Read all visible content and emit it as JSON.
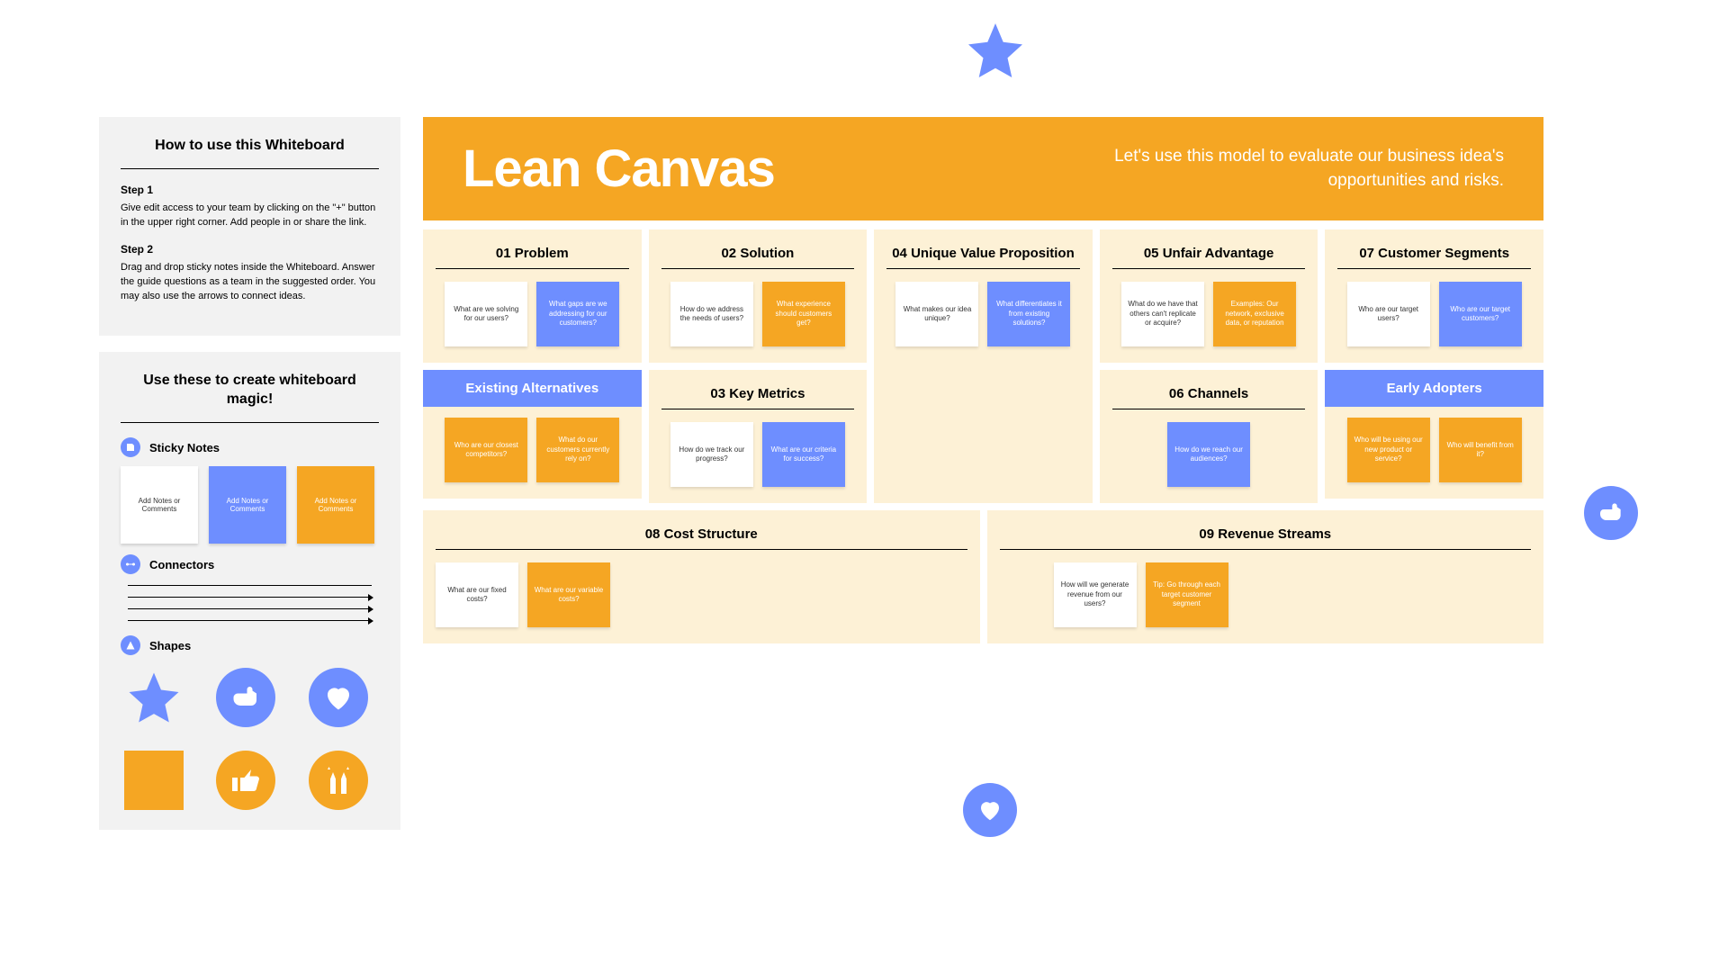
{
  "sidebar": {
    "howto_title": "How to use this Whiteboard",
    "step1_h": "Step 1",
    "step1_body": "Give edit access to your team by clicking on the \"+\" button in the upper right corner. Add people in or share the link.",
    "step2_h": "Step 2",
    "step2_body": "Drag and drop sticky notes inside the Whiteboard. Answer the guide questions as a team in the suggested order. You may also use the arrows to connect ideas.",
    "magic_title": "Use these to create whiteboard magic!",
    "sticky_label": "Sticky Notes",
    "sticky_white": "Add Notes or Comments",
    "sticky_blue": "Add Notes or Comments",
    "sticky_orange": "Add Notes or Comments",
    "connectors_label": "Connectors",
    "shapes_label": "Shapes"
  },
  "banner": {
    "title": "Lean Canvas",
    "subtitle": "Let's use this model to evaluate our business idea's opportunities and risks."
  },
  "blocks": {
    "problem": {
      "h": "01 Problem",
      "n1": "What are we solving for our users?",
      "n2": "What gaps are we addressing for our customers?"
    },
    "existing": {
      "h": "Existing Alternatives",
      "n1": "Who are our closest competitors?",
      "n2": "What do our customers currently rely on?"
    },
    "solution": {
      "h": "02 Solution",
      "n1": "How do we address the needs of users?",
      "n2": "What experience should customers get?"
    },
    "metrics": {
      "h": "03 Key Metrics",
      "n1": "How do we track our progress?",
      "n2": "What are our criteria for success?"
    },
    "uvp": {
      "h": "04 Unique Value Proposition",
      "n1": "What makes our idea unique?",
      "n2": "What differentiates it from existing solutions?"
    },
    "unfair": {
      "h": "05 Unfair Advantage",
      "n1": "What do we have that others can't replicate or acquire?",
      "n2": "Examples: Our network, exclusive data, or reputation"
    },
    "channels": {
      "h": "06 Channels",
      "n1": "How do we reach our audiences?"
    },
    "segments": {
      "h": "07 Customer Segments",
      "n1": "Who are our target users?",
      "n2": "Who are our target customers?"
    },
    "adopters": {
      "h": "Early Adopters",
      "n1": "Who will be using our new product or service?",
      "n2": "Who will benefit from it?"
    },
    "cost": {
      "h": "08 Cost Structure",
      "n1": "What are our fixed costs?",
      "n2": "What are our variable costs?"
    },
    "revenue": {
      "h": "09 Revenue Streams",
      "n1": "How will we generate revenue from our users?",
      "n2": "Tip: Go through each target customer segment"
    }
  }
}
